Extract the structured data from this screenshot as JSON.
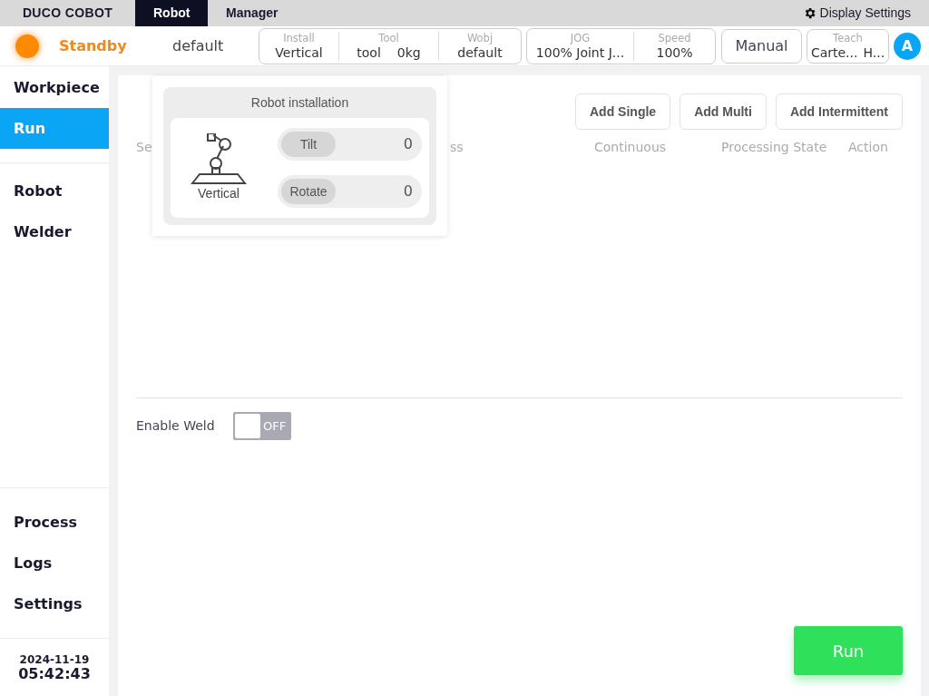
{
  "top_bar": {
    "logo": "DUCO COBOT",
    "tabs": [
      {
        "label": "Robot",
        "selected": true
      },
      {
        "label": "Manager",
        "selected": false
      }
    ],
    "display_settings": "Display Settings"
  },
  "status_bar": {
    "state": "Standby",
    "program": "default",
    "install": {
      "label": "Install",
      "value": "Vertical"
    },
    "tool": {
      "label": "Tool",
      "name": "tool",
      "mass": "0kg"
    },
    "wobj": {
      "label": "Wobj",
      "value": "default"
    },
    "jog": {
      "label": "JOG",
      "value": "100% Joint J..."
    },
    "speed": {
      "label": "Speed",
      "value": "100%"
    },
    "mode": "Manual",
    "teach": {
      "label": "Teach",
      "values": [
        "Carte...",
        "H..."
      ]
    },
    "avatar": "A"
  },
  "sidebar": {
    "top_items": [
      {
        "label": "Workpiece",
        "selected": false
      },
      {
        "label": "Run",
        "selected": true
      }
    ],
    "middle_items": [
      {
        "label": "Robot",
        "selected": false
      },
      {
        "label": "Welder",
        "selected": false
      }
    ],
    "bottom_items": [
      {
        "label": "Process",
        "selected": false
      },
      {
        "label": "Logs",
        "selected": false
      },
      {
        "label": "Settings",
        "selected": false
      }
    ],
    "date": "2024-11-19",
    "time": "05:42:43"
  },
  "toolbar": [
    "Add Single",
    "Add Multi",
    "Add Intermittent"
  ],
  "table": {
    "columns": [
      "Se",
      "ss",
      "Continuous",
      "Processing State",
      "Action"
    ]
  },
  "enable_weld": {
    "label": "Enable Weld",
    "on": false,
    "state_text": "OFF"
  },
  "run_button": "Run",
  "popover": {
    "title": "Robot installation",
    "mount": "Vertical",
    "fields": [
      {
        "label": "Tilt",
        "value": "0"
      },
      {
        "label": "Rotate",
        "value": "0"
      }
    ]
  }
}
